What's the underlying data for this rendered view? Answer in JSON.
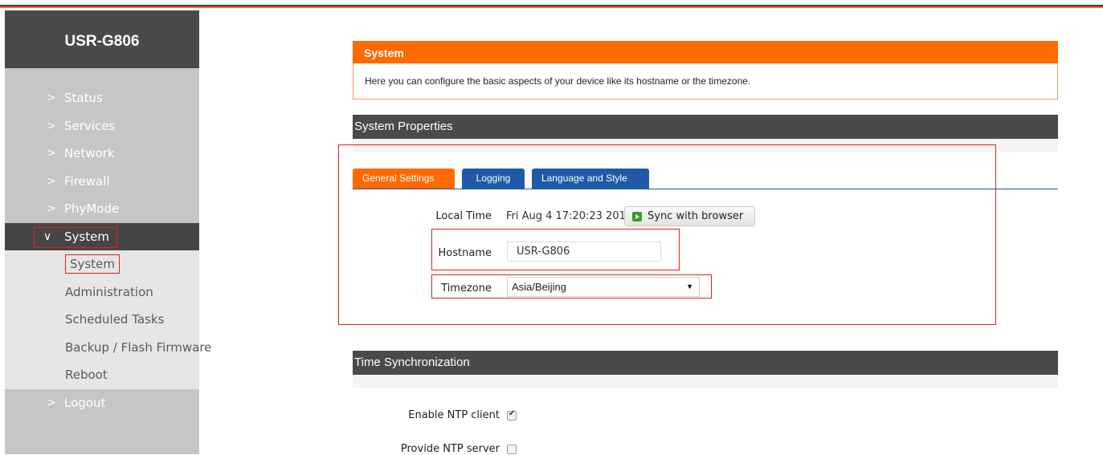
{
  "brand": "USR-G806",
  "nav": {
    "status": "Status",
    "services": "Services",
    "network": "Network",
    "firewall": "Firewall",
    "phymode": "PhyMode",
    "system": "System",
    "logout": "Logout"
  },
  "subnav": {
    "system": "System",
    "administration": "Administration",
    "scheduled_tasks": "Scheduled Tasks",
    "backup": "Backup / Flash Firmware",
    "reboot": "Reboot"
  },
  "page": {
    "title": "System",
    "description": "Here you can configure the basic aspects of your device like its hostname or the timezone."
  },
  "properties": {
    "title": "System Properties",
    "tabs": {
      "general": "General Settings",
      "logging": "Logging",
      "language": "Language and Style"
    },
    "local_time_label": "Local Time",
    "local_time_value": "Fri Aug 4 17:20:23 2017",
    "sync_button": "Sync with browser",
    "hostname_label": "Hostname",
    "hostname_value": "USR-G806",
    "timezone_label": "Timezone",
    "timezone_value": "Asia/Beijing"
  },
  "timesync": {
    "title": "Time Synchronization",
    "enable_ntp_label": "Enable NTP client",
    "enable_ntp_checked": true,
    "provide_ntp_label": "Provide NTP server",
    "provide_ntp_checked": false
  },
  "colors": {
    "accent": "#ff6a00",
    "tab_blue": "#1e5aa8",
    "header_dark": "#4a4a4a",
    "highlight_red": "#e02020"
  }
}
